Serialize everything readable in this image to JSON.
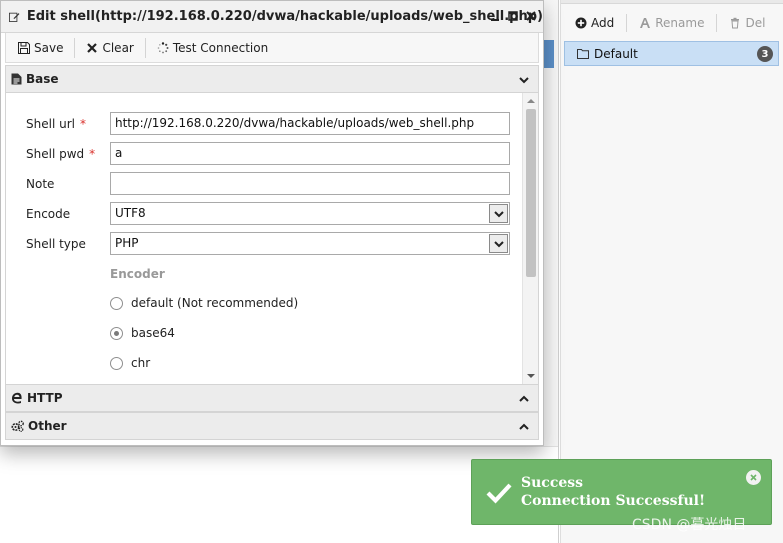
{
  "dialog": {
    "title": "Edit shell(http://192.168.0.220/dvwa/hackable/uploads/web_shell.php)",
    "toolbar": {
      "save_label": "Save",
      "clear_label": "Clear",
      "test_label": "Test Connection"
    },
    "sections": {
      "base": "Base",
      "http": "HTTP",
      "other": "Other"
    },
    "form": {
      "shell_url": {
        "label": "Shell url",
        "required_mark": "*",
        "value": "http://192.168.0.220/dvwa/hackable/uploads/web_shell.php"
      },
      "shell_pwd": {
        "label": "Shell pwd",
        "required_mark": "*",
        "value": "a"
      },
      "note": {
        "label": "Note",
        "value": ""
      },
      "encode": {
        "label": "Encode",
        "value": "UTF8"
      },
      "shell_type": {
        "label": "Shell type",
        "value": "PHP"
      },
      "encoder": {
        "title": "Encoder",
        "options": [
          {
            "label": "default (Not recommended)",
            "checked": false
          },
          {
            "label": "base64",
            "checked": true
          },
          {
            "label": "chr",
            "checked": false
          }
        ]
      }
    }
  },
  "right_panel": {
    "toolbar": {
      "add_label": "Add",
      "rename_label": "Rename",
      "del_label": "Del"
    },
    "tree": {
      "item_label": "Default",
      "badge": "3"
    }
  },
  "toast": {
    "title": "Success",
    "message": "Connection Successful!"
  },
  "watermark": "CSDN @暮光烛日",
  "colors": {
    "toast_bg": "#6fb66a",
    "selection_bg": "#c9dff5",
    "required": "#d9302b"
  }
}
